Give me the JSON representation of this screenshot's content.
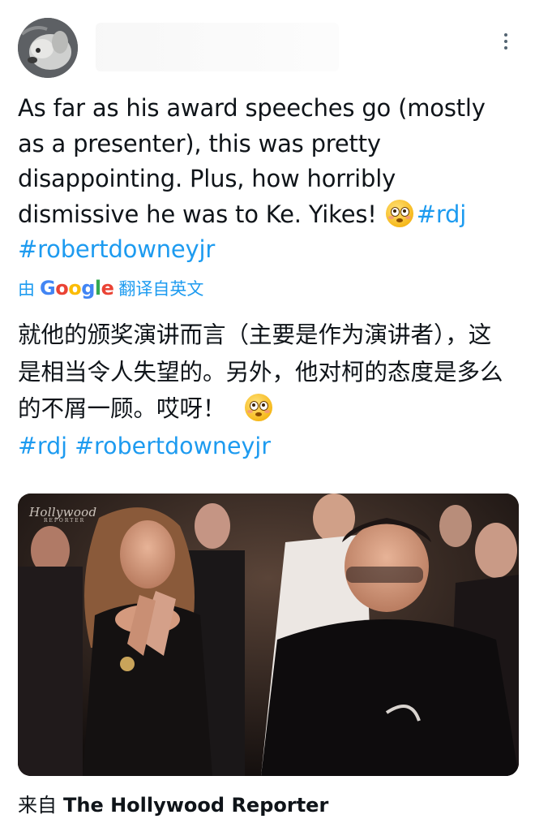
{
  "tweet": {
    "text_part1": "As far as his award speeches go (mostly as a presenter), this was pretty disappointing. Plus, how horribly dismissive he was to Ke. Yikes! ",
    "emoji": "flushed-face",
    "hashtag_1": "#rdj",
    "hashtag_2": "#robertdowneyjr"
  },
  "translation": {
    "prefix": "由",
    "provider_letters": [
      "G",
      "o",
      "o",
      "g",
      "l",
      "e"
    ],
    "suffix": "翻译自英文",
    "text": "就他的颁奖演讲而言（主要是作为演讲者），这是相当令人失望的。另外，他对柯的态度是多么的不屑一顾。哎呀！",
    "hashtag_1": "#rdj",
    "hashtag_2": "#robertdowneyjr"
  },
  "media": {
    "watermark": "Hollywood",
    "watermark_sub": "REPORTER"
  },
  "source": {
    "prefix": "来自",
    "name": "The Hollywood Reporter"
  },
  "colors": {
    "link": "#1d9bf0",
    "text": "#0f1419",
    "muted": "#536471"
  }
}
